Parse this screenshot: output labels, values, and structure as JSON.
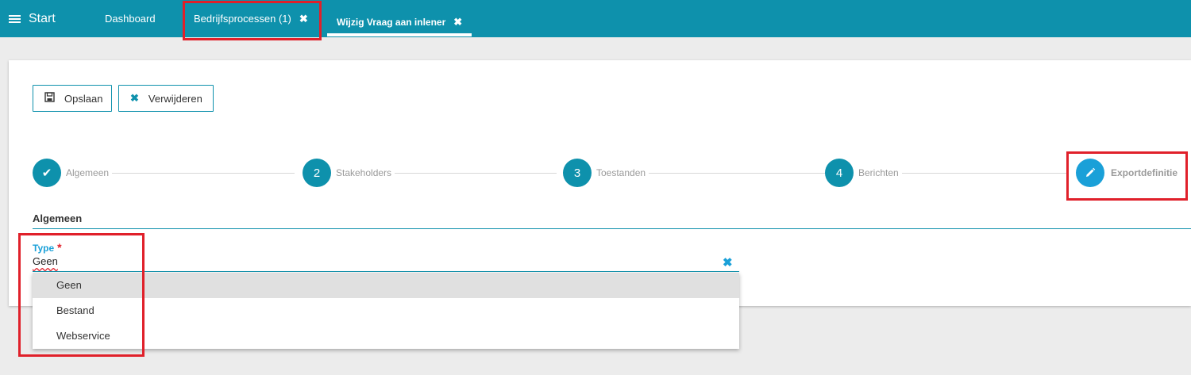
{
  "nav": {
    "start_label": "Start",
    "tabs": [
      {
        "label": "Dashboard"
      },
      {
        "label": "Bedrijfsprocessen (1)",
        "close": "✖"
      },
      {
        "label": "Wijzig Vraag aan inlener",
        "close": "✖"
      }
    ]
  },
  "toolbar": {
    "save_label": "Opslaan",
    "save_icon": "save-icon",
    "delete_label": "Verwijderen",
    "delete_icon": "close-icon"
  },
  "steps": [
    {
      "marker": "✔",
      "label": "Algemeen"
    },
    {
      "marker": "2",
      "label": "Stakeholders"
    },
    {
      "marker": "3",
      "label": "Toestanden"
    },
    {
      "marker": "4",
      "label": "Berichten"
    },
    {
      "marker": "pencil-icon",
      "label": "Exportdefinitie"
    }
  ],
  "section": {
    "title": "Algemeen"
  },
  "type_field": {
    "label": "Type",
    "required_mark": "*",
    "value": "Geen",
    "clear": "✖"
  },
  "dropdown": {
    "options": [
      "Geen",
      "Bestand",
      "Webservice"
    ],
    "selected": "Geen"
  },
  "colors": {
    "accent": "#0e91ac",
    "highlight": "#1aa0d8",
    "annotation": "#e0202a"
  }
}
